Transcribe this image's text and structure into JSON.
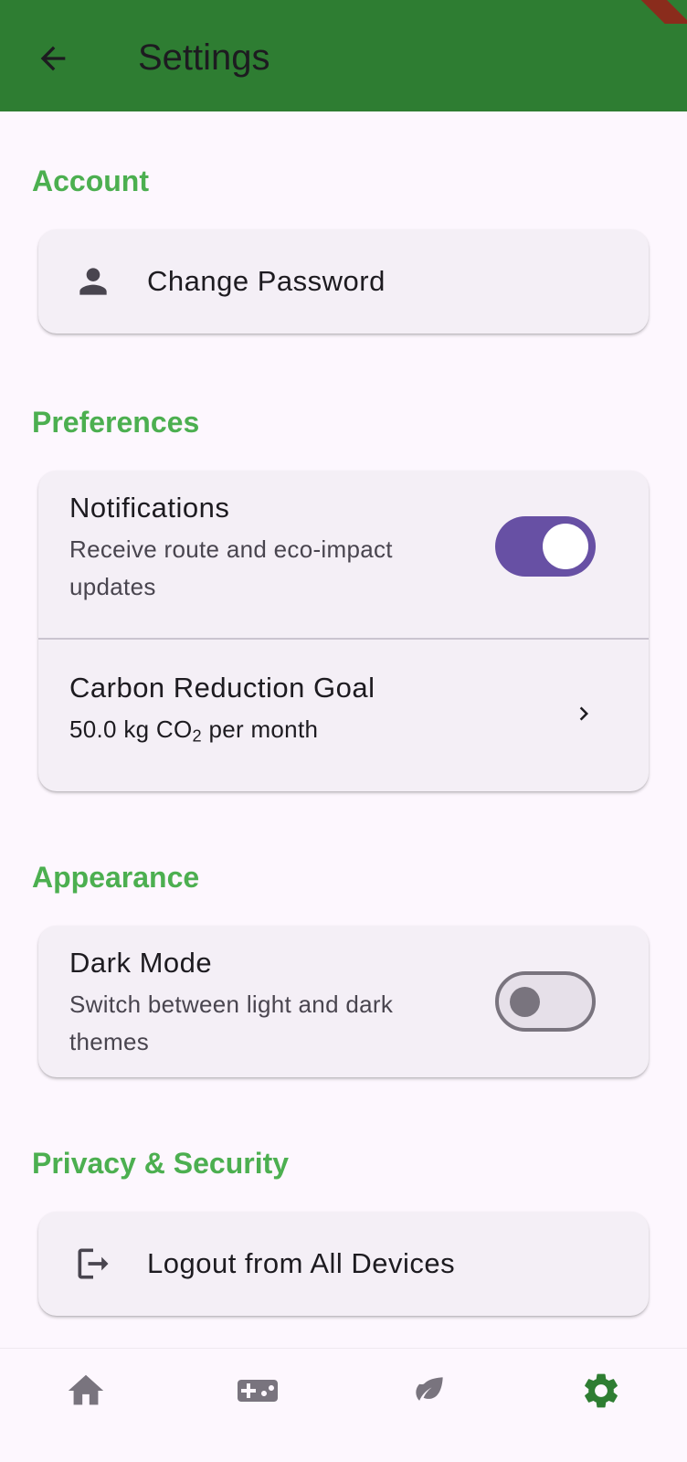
{
  "appbar": {
    "title": "Settings",
    "back_icon": "arrow-back-icon",
    "color": "#2e7d32"
  },
  "sections": {
    "account": {
      "title": "Account",
      "change_password": {
        "label": "Change Password",
        "icon": "person-icon"
      }
    },
    "preferences": {
      "title": "Preferences",
      "notifications": {
        "title": "Notifications",
        "subtitle_line1": "Receive route and eco-impact",
        "subtitle_line2": "updates",
        "enabled": true
      },
      "carbon_goal": {
        "title": "Carbon Reduction Goal",
        "value": "50.0 kg CO",
        "sub": "2",
        "suffix": " per month",
        "icon": "chevron-right-icon"
      }
    },
    "appearance": {
      "title": "Appearance",
      "dark_mode": {
        "title": "Dark Mode",
        "subtitle_line1": "Switch between light and dark",
        "subtitle_line2": "themes",
        "enabled": false
      }
    },
    "privacy": {
      "title": "Privacy & Security",
      "logout_all": {
        "label": "Logout from All Devices",
        "icon": "logout-icon"
      }
    }
  },
  "bottom_nav": {
    "items": [
      {
        "name": "home",
        "icon": "home-icon",
        "active": false
      },
      {
        "name": "games",
        "icon": "gamepad-icon",
        "active": false
      },
      {
        "name": "eco",
        "icon": "leaf-icon",
        "active": false
      },
      {
        "name": "settings",
        "icon": "gear-icon",
        "active": true
      }
    ],
    "active_color": "#2e7d32",
    "inactive_color": "#79747e"
  },
  "accent": "#4caf50",
  "switch_on_color": "#6750a4"
}
